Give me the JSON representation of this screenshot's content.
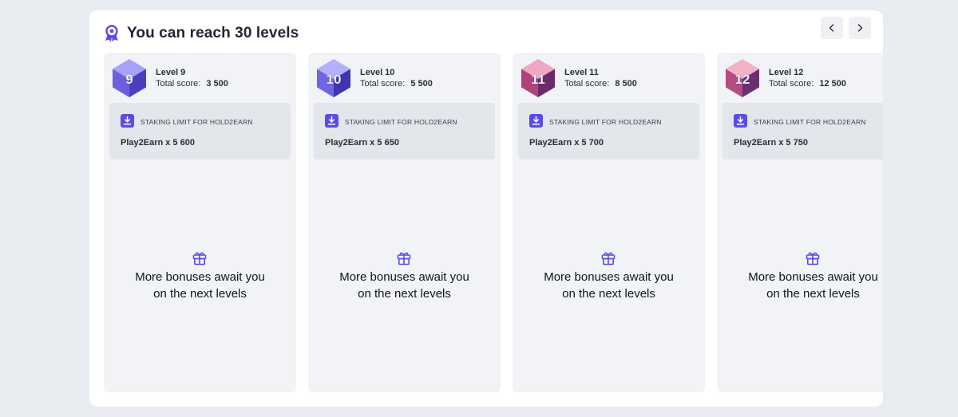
{
  "header": {
    "title": "You can reach 30 levels",
    "icon": "medal-icon",
    "prev_icon": "chevron-left-icon",
    "next_icon": "chevron-right-icon"
  },
  "colors": {
    "accent": "#5b4be8",
    "card_bg": "#f1f3f6",
    "perk_bg": "#e3e6ea"
  },
  "levels": [
    {
      "number": "9",
      "name": "Level 9",
      "score_label": "Total score:",
      "score": "3 500",
      "badge_colors": [
        "#a8a2f7",
        "#6c5fe0",
        "#4b3fc0"
      ],
      "perk_label": "STAKING LIMIT FOR HOLD2EARN",
      "perk_value": "Play2Earn x 5 600",
      "bonus_line1": "More bonuses await you",
      "bonus_line2": "on the next levels"
    },
    {
      "number": "10",
      "name": "Level 10",
      "score_label": "Total score:",
      "score": "5 500",
      "badge_colors": [
        "#b5b0fb",
        "#6f66e6",
        "#3f36b0"
      ],
      "perk_label": "STAKING LIMIT FOR HOLD2EARN",
      "perk_value": "Play2Earn x 5 650",
      "bonus_line1": "More bonuses await you",
      "bonus_line2": "on the next levels"
    },
    {
      "number": "11",
      "name": "Level 11",
      "score_label": "Total score:",
      "score": "8 500",
      "badge_colors": [
        "#f0a8c2",
        "#b2427a",
        "#6d2a6a"
      ],
      "perk_label": "STAKING LIMIT FOR HOLD2EARN",
      "perk_value": "Play2Earn x 5 700",
      "bonus_line1": "More bonuses await you",
      "bonus_line2": "on the next levels"
    },
    {
      "number": "12",
      "name": "Level 12",
      "score_label": "Total score:",
      "score": "12 500",
      "badge_colors": [
        "#f2b2c8",
        "#b24c82",
        "#6a2e72"
      ],
      "perk_label": "STAKING LIMIT FOR HOLD2EARN",
      "perk_value": "Play2Earn x 5 750",
      "bonus_line1": "More bonuses await you",
      "bonus_line2": "on the next levels"
    }
  ]
}
